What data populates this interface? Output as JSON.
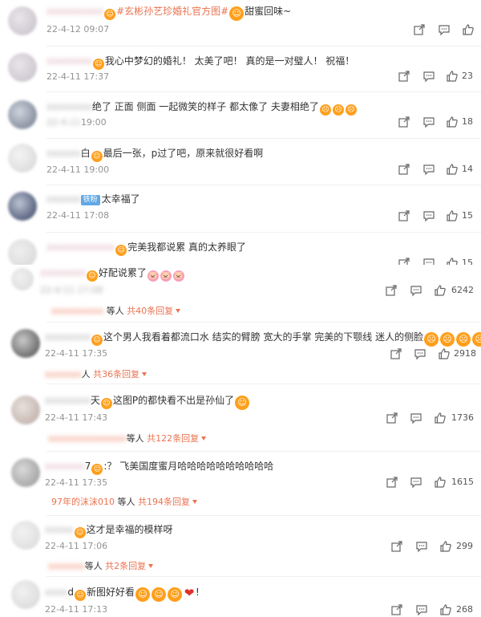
{
  "comments": [
    {
      "user": "",
      "text": "#玄彬孙艺珍婚礼官方图#",
      "text2": "甜蜜回味~",
      "time": "22-4-12 09:07",
      "likes": ""
    },
    {
      "user": "",
      "text": "我心中梦幻的婚礼！ 太美了吧！ 真的是一对璧人！ 祝福！",
      "time": "22-4-11 17:37",
      "likes": "23"
    },
    {
      "user": "",
      "text": "绝了 正面 侧面 一起微笑的样子 都太像了 夫妻相绝了",
      "time": "19:00",
      "likes": "18"
    },
    {
      "user": "白",
      "text": "最后一张，p过了吧，原来就很好看啊",
      "time": "22-4-11 19:00",
      "likes": "14"
    },
    {
      "user": "",
      "badge": "铁粉",
      "text": "太幸福了",
      "time": "22-4-11 17:08",
      "likes": "15"
    },
    {
      "user": "",
      "text": "完美我都说累 真的太养眼了",
      "time": "",
      "likes": "15"
    },
    {
      "user": "",
      "text": "好配说累了",
      "time": "",
      "likes": "6242",
      "reply_users": "",
      "reply_suffix": "等人",
      "reply_count": "共40条回复"
    },
    {
      "user": "",
      "text": "这个男人我看着都流口水 结实的臂膀 宽大的手掌 完美的下颚线 迷人的侧脸",
      "time": "22-4-11 17:35",
      "likes": "2918",
      "reply_users": "",
      "reply_suffix": "人",
      "reply_count": "共36条回复"
    },
    {
      "user": "天",
      "text": "这图P的都快看不出是孙仙了",
      "time": "22-4-11 17:43",
      "likes": "1736",
      "reply_users": "",
      "reply_suffix": "等人",
      "reply_count": "共122条回复"
    },
    {
      "user": "7",
      "text": ":？ 飞美国度蜜月哈哈哈哈哈哈哈哈哈哈",
      "time": "22-4-11 17:35",
      "likes": "1615",
      "reply_users": "97年的沫沫010",
      "reply_suffix": "等人",
      "reply_count": "共194条回复"
    },
    {
      "user": "",
      "text": "这才是幸福的模样呀",
      "time": "22-4-11 17:06",
      "likes": "299",
      "reply_users": "",
      "reply_suffix": "等人",
      "reply_count": "共2条回复"
    },
    {
      "user": "d",
      "text": "新图好好看",
      "text2": "!",
      "time": "22-4-11 17:13",
      "likes": "268"
    }
  ],
  "icons": {
    "share": "share-icon",
    "comment": "comment-icon",
    "like": "thumbs-up-icon"
  },
  "colors": {
    "link": "#eb7350",
    "time": "#939393",
    "badge": "#62a8e5"
  }
}
